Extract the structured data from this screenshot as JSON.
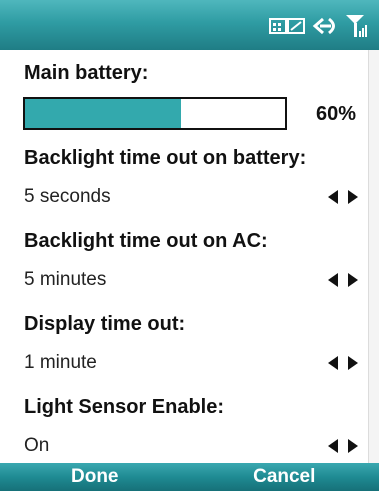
{
  "status_icons": [
    "battery-signal-icon",
    "connectivity-icon",
    "signal-strength-icon"
  ],
  "main_battery": {
    "label": "Main battery:",
    "percent_text": "60%",
    "level_fraction": 0.6
  },
  "settings": [
    {
      "label": "Backlight time out on battery:",
      "value": "5 seconds"
    },
    {
      "label": "Backlight time out on AC:",
      "value": "5 minutes"
    },
    {
      "label": "Display time out:",
      "value": "1 minute"
    },
    {
      "label": "Light Sensor Enable:",
      "value": "On"
    }
  ],
  "softkeys": {
    "left": "Done",
    "right": "Cancel"
  },
  "colors": {
    "accent": "#2f9ca3",
    "battery_fill": "#33a9ad"
  }
}
